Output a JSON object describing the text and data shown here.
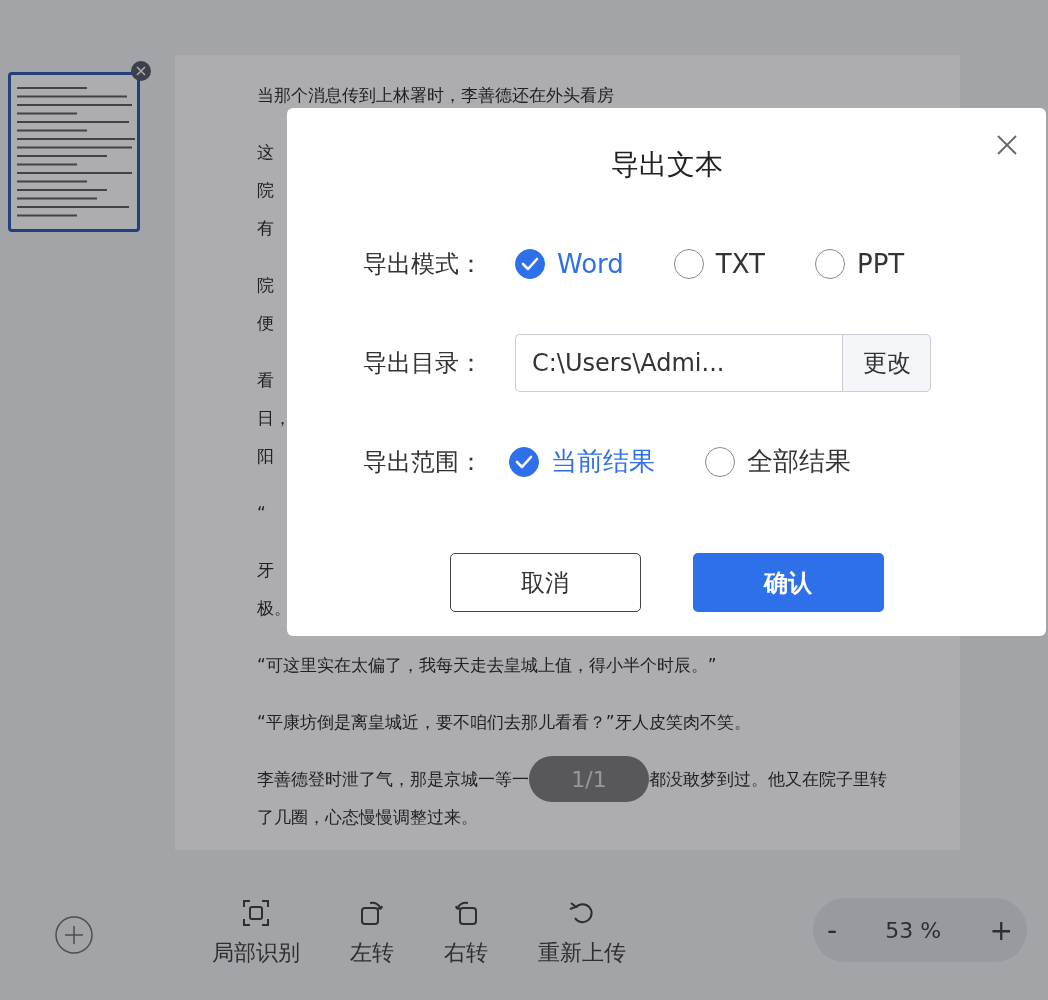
{
  "thumbnails": [
    {
      "selected": true
    }
  ],
  "document": {
    "paragraphs": [
      [
        "当那个消息传到上林署时，李善德还在外头看房"
      ],
      [
        "这",
        "院",
        "有"
      ],
      [
        "院",
        "便"
      ],
      [
        "看",
        "日，",
        "阳"
      ],
      [
        "“"
      ],
      [
        "牙",
        "极。"
      ],
      [
        "“可这里实在太偏了，我每天走去皇城上值，得小半个时辰。”"
      ],
      [
        "“平康坊倒是离皇城近，要不咱们去那儿看看？”牙人皮笑肉不笑。"
      ],
      [
        [
          "李善德登时泄了气，那是京城一等一",
          "都没敢梦到过。他又在院子里转"
        ],
        "了几圈，心态慢慢调整过来。"
      ]
    ]
  },
  "page_indicator": "1/1",
  "toolbar": [
    {
      "label": "局部识别",
      "kind": "crop"
    },
    {
      "label": "左转",
      "kind": "rotate-left"
    },
    {
      "label": "右转",
      "kind": "rotate-right"
    },
    {
      "label": "重新上传",
      "kind": "reload"
    }
  ],
  "zoom": {
    "minus": "-",
    "value": "53 %",
    "plus": "+"
  },
  "dialog": {
    "title": "导出文本",
    "rows": [
      {
        "kind": "radios",
        "label": "导出模式：",
        "options": [
          {
            "label": "Word",
            "selected": true
          },
          {
            "label": "TXT",
            "selected": false
          },
          {
            "label": "PPT",
            "selected": false
          }
        ]
      },
      {
        "kind": "path",
        "label": "导出目录：",
        "value": "C:\\Users\\Admi...",
        "button": "更改"
      },
      {
        "kind": "radios",
        "label": "导出范围：",
        "options": [
          {
            "label": "当前结果",
            "selected": true
          },
          {
            "label": "全部结果",
            "selected": false
          }
        ]
      }
    ],
    "buttons": [
      {
        "label": "取消",
        "kind": "secondary"
      },
      {
        "label": "确认",
        "kind": "primary"
      }
    ]
  }
}
